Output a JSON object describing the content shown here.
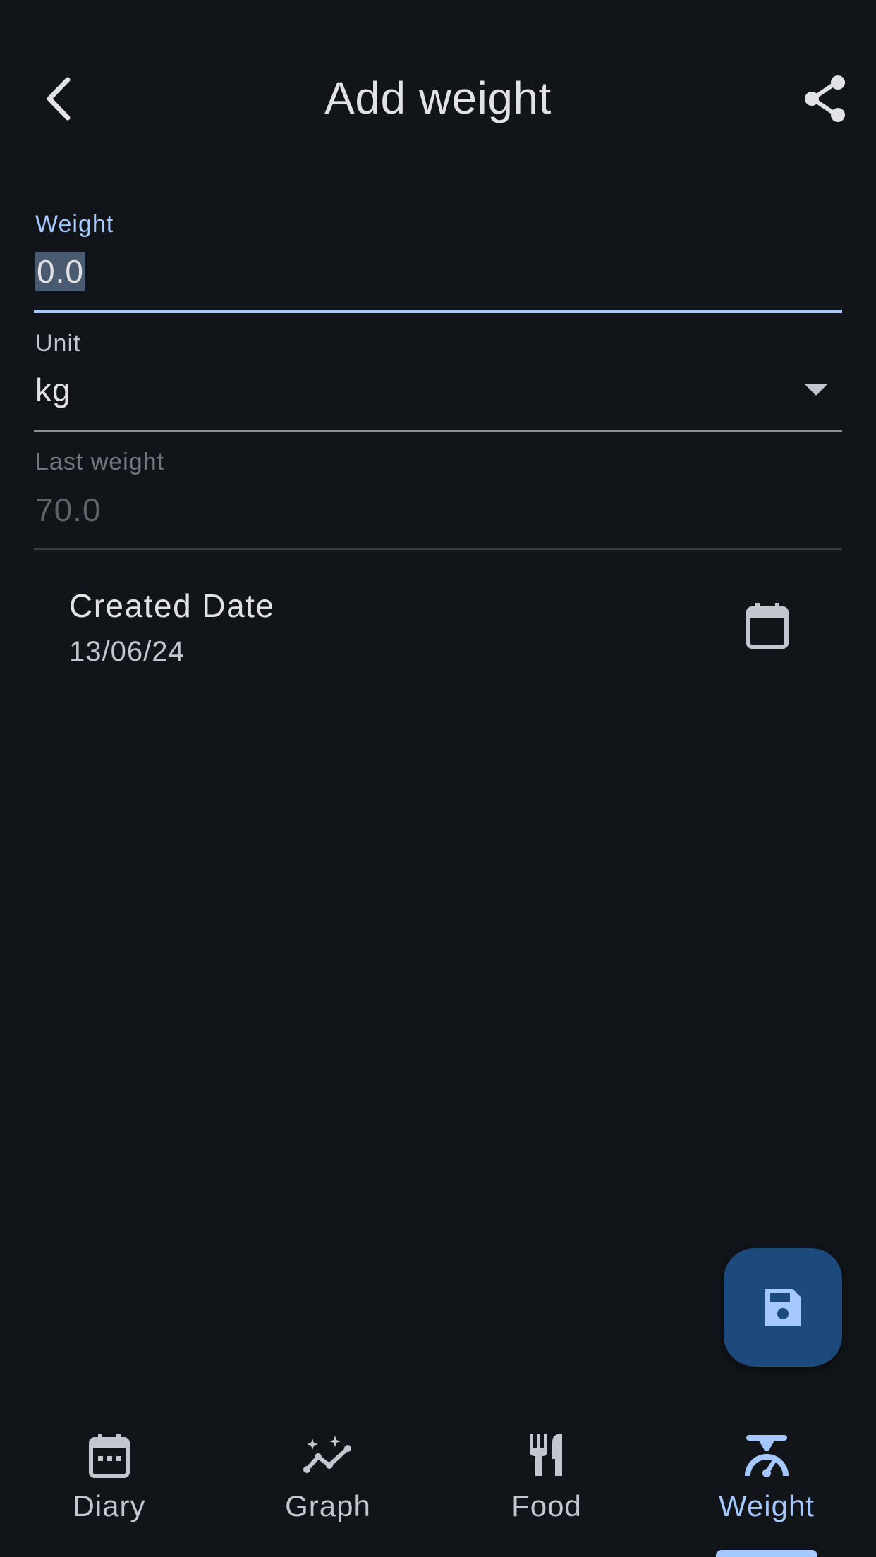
{
  "header": {
    "title": "Add weight",
    "back_icon": "chevron-left-icon",
    "share_icon": "share-icon"
  },
  "form": {
    "weight": {
      "label": "Weight",
      "value": "0.0"
    },
    "unit": {
      "label": "Unit",
      "value": "kg"
    },
    "last_weight": {
      "label": "Last weight",
      "value": "70.0"
    },
    "created_date": {
      "label": "Created Date",
      "value": "13/06/24",
      "icon": "calendar-icon"
    }
  },
  "fab": {
    "icon": "save-icon"
  },
  "bottom_nav": {
    "items": [
      {
        "label": "Diary",
        "icon": "calendar-icon",
        "active": false
      },
      {
        "label": "Graph",
        "icon": "graph-icon",
        "active": false
      },
      {
        "label": "Food",
        "icon": "restaurant-icon",
        "active": false
      },
      {
        "label": "Weight",
        "icon": "scale-icon",
        "active": true
      }
    ]
  },
  "colors": {
    "background": "#111418",
    "accent": "#a4c8ff",
    "fab": "#1c4a7c",
    "text": "#e2e2e6",
    "muted": "#74777f"
  }
}
